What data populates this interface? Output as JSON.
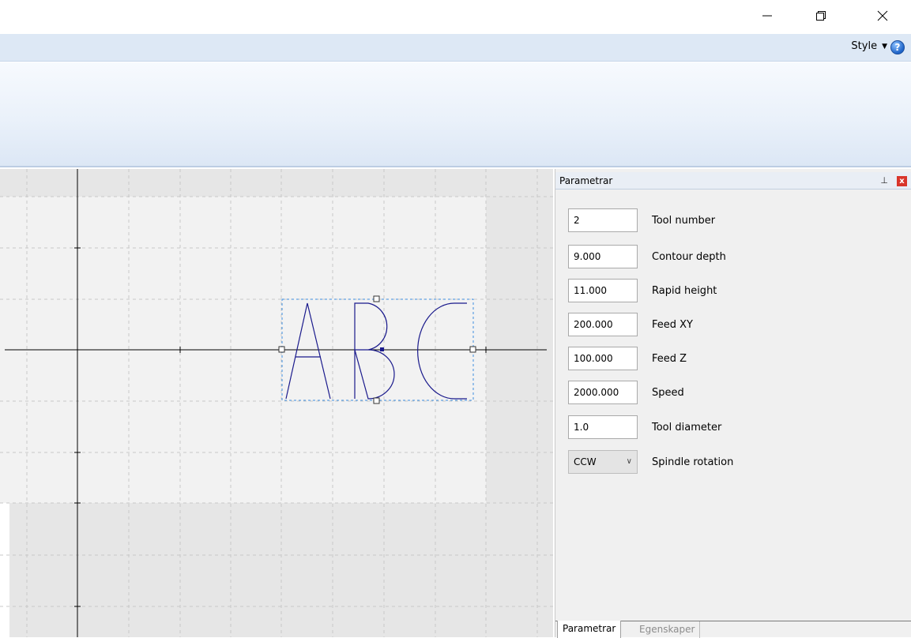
{
  "ribbon": {
    "style_label": "Style",
    "help_symbol": "?"
  },
  "panel": {
    "title": "Parametrar",
    "pin_symbol": "⊥",
    "close_symbol": "x",
    "fields": [
      {
        "value": "2",
        "label": "Tool number"
      },
      {
        "value": "9.000",
        "label": "Contour depth"
      },
      {
        "value": "11.000",
        "label": "Rapid height"
      },
      {
        "value": "200.000",
        "label": "Feed XY"
      },
      {
        "value": "100.000",
        "label": "Feed Z"
      },
      {
        "value": "2000.000",
        "label": "Speed"
      },
      {
        "value": "1.0",
        "label": "Tool diameter"
      }
    ],
    "spindle": {
      "value": "CCW",
      "label": "Spindle rotation"
    },
    "tabs": [
      "Parametrar",
      "Egenskaper"
    ]
  },
  "canvas": {
    "text": "ABC",
    "stroke_color": "#1a1a8c",
    "selection_color": "#3d8fe0"
  },
  "icons": [
    "minimize-icon",
    "restore-icon",
    "close-icon",
    "help-icon",
    "pin-icon"
  ]
}
